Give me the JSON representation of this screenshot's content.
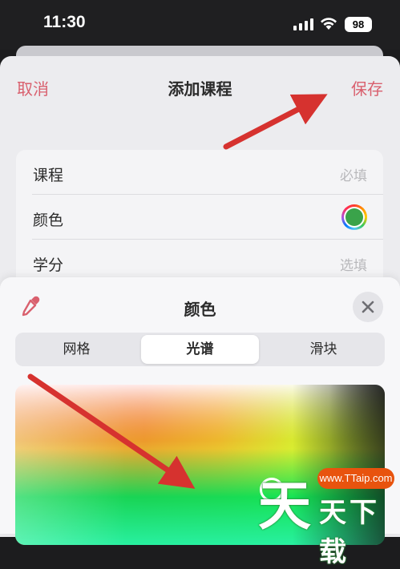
{
  "status_bar": {
    "time": "11:30",
    "battery": "98",
    "signal_icon": "cellular-signal",
    "wifi_icon": "wifi"
  },
  "nav": {
    "cancel": "取消",
    "title": "添加课程",
    "save": "保存"
  },
  "form": {
    "rows": [
      {
        "label": "课程",
        "value": "必填"
      },
      {
        "label": "颜色",
        "value": ""
      },
      {
        "label": "学分",
        "value": "选填"
      }
    ]
  },
  "picker": {
    "title": "颜色",
    "tabs": [
      "网格",
      "光谱",
      "滑块"
    ],
    "active_tab": "光谱",
    "close_icon": "xmark",
    "dropper_icon": "eyedropper"
  },
  "watermark": {
    "badge": "www.TTaip.com",
    "big": "天",
    "small": "天下载"
  },
  "colors": {
    "accent": "#d9606e",
    "annotation_arrow": "#d6322f",
    "selected_color": "#3aa34a"
  }
}
